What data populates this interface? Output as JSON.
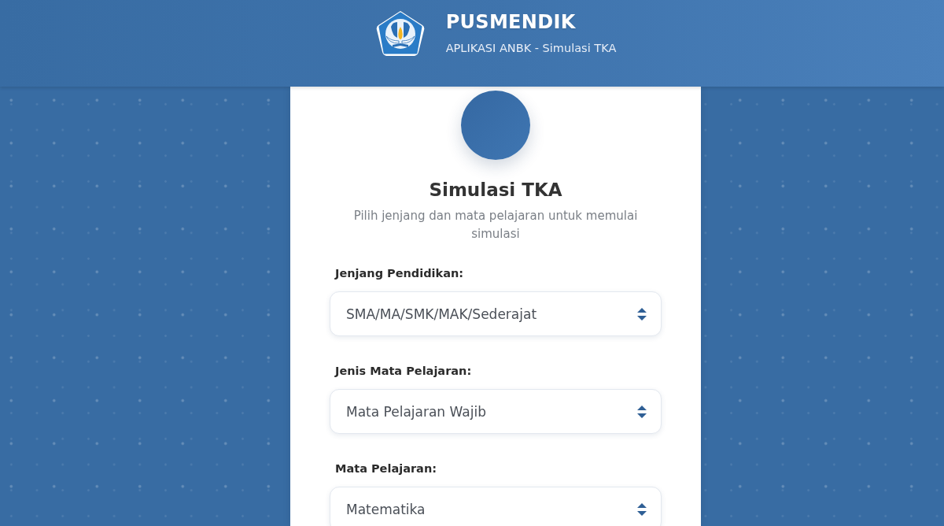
{
  "header": {
    "title": "PUSMENDIK",
    "subtitle": "APLIKASI ANBK - Simulasi TKA"
  },
  "card": {
    "title": "Simulasi TKA",
    "description": "Pilih jenjang dan mata pelajaran untuk memulai simulasi"
  },
  "fields": [
    {
      "label": "Jenjang Pendidikan:",
      "value": "SMA/MA/SMK/MAK/Sederajat"
    },
    {
      "label": "Jenis Mata Pelajaran:",
      "value": "Mata Pelajaran Wajib"
    },
    {
      "label": "Mata Pelajaran:",
      "value": "Matematika"
    }
  ]
}
